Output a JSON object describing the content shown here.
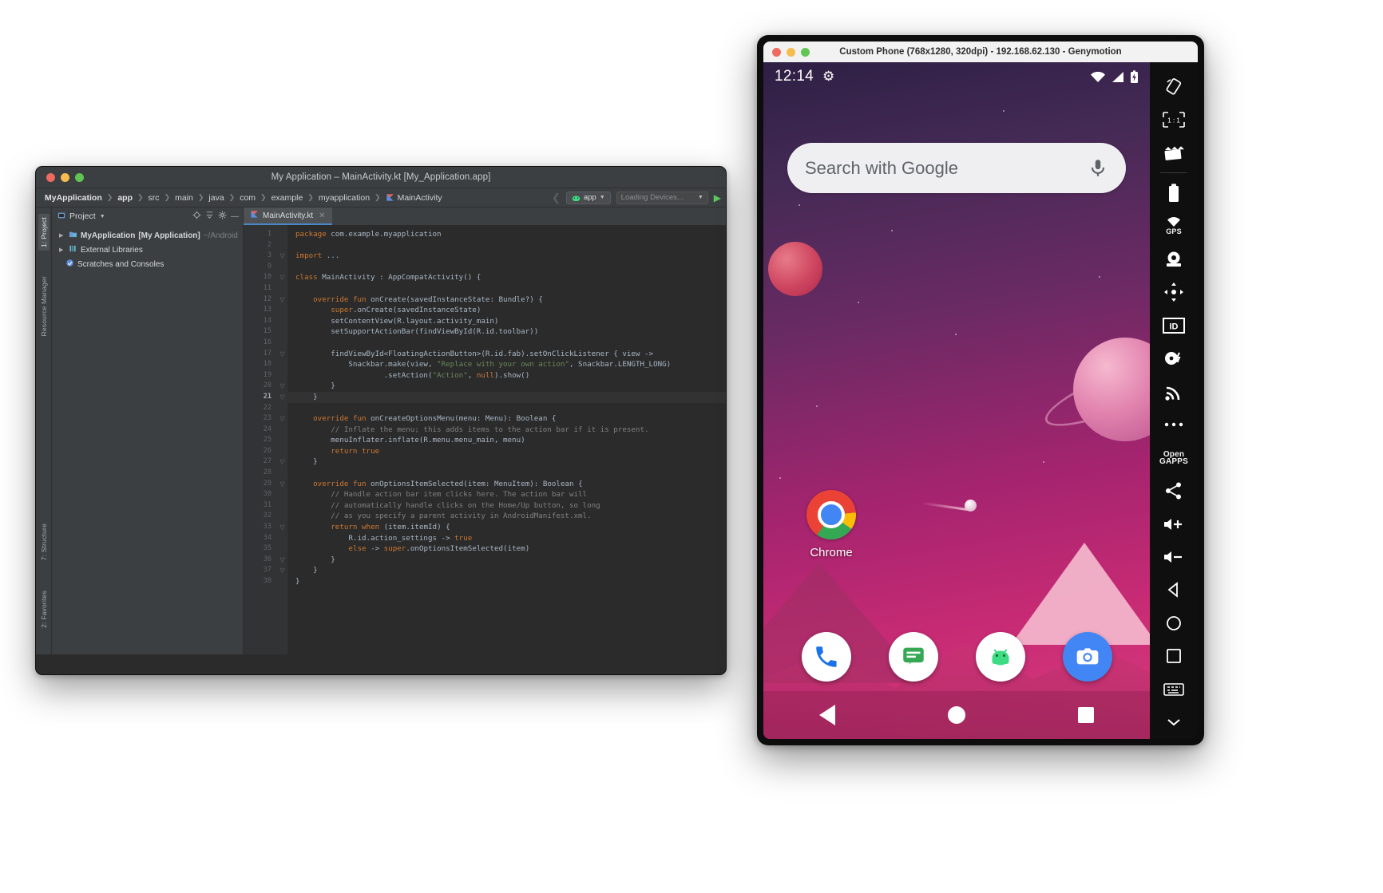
{
  "ide": {
    "title": "My Application – MainActivity.kt [My_Application.app]",
    "breadcrumb": [
      "MyApplication",
      "app",
      "src",
      "main",
      "java",
      "com",
      "example",
      "myapplication",
      "MainActivity"
    ],
    "run_config": "app",
    "device_selector": "Loading Devices...",
    "project_pane": {
      "title": "Project",
      "tree": [
        {
          "label": "MyApplication",
          "bracket": "[My Application]",
          "path": "~/Android",
          "icon": "module-icon"
        },
        {
          "label": "External Libraries",
          "bracket": "",
          "path": "",
          "icon": "library-icon"
        },
        {
          "label": "Scratches and Consoles",
          "bracket": "",
          "path": "",
          "icon": "scratch-icon"
        }
      ]
    },
    "tool_rail": [
      "1: Project",
      "Resource Manager",
      "7: Structure",
      "2: Favorites"
    ],
    "tab": {
      "label": "MainActivity.kt"
    },
    "editor": {
      "current_line": 21,
      "lines": [
        {
          "n": 1,
          "text": "package com.example.myapplication"
        },
        {
          "n": 2,
          "text": ""
        },
        {
          "n": 3,
          "text": "import ..."
        },
        {
          "n": 9,
          "text": ""
        },
        {
          "n": 10,
          "text": "class MainActivity : AppCompatActivity() {"
        },
        {
          "n": 11,
          "text": ""
        },
        {
          "n": 12,
          "text": "    override fun onCreate(savedInstanceState: Bundle?) {"
        },
        {
          "n": 13,
          "text": "        super.onCreate(savedInstanceState)"
        },
        {
          "n": 14,
          "text": "        setContentView(R.layout.activity_main)"
        },
        {
          "n": 15,
          "text": "        setSupportActionBar(findViewById(R.id.toolbar))"
        },
        {
          "n": 16,
          "text": ""
        },
        {
          "n": 17,
          "text": "        findViewById<FloatingActionButton>(R.id.fab).setOnClickListener { view ->"
        },
        {
          "n": 18,
          "text": "            Snackbar.make(view, \"Replace with your own action\", Snackbar.LENGTH_LONG)"
        },
        {
          "n": 19,
          "text": "                    .setAction(\"Action\", null).show()"
        },
        {
          "n": 20,
          "text": "        }"
        },
        {
          "n": 21,
          "text": "    }"
        },
        {
          "n": 22,
          "text": ""
        },
        {
          "n": 23,
          "text": "    override fun onCreateOptionsMenu(menu: Menu): Boolean {"
        },
        {
          "n": 24,
          "text": "        // Inflate the menu; this adds items to the action bar if it is present."
        },
        {
          "n": 25,
          "text": "        menuInflater.inflate(R.menu.menu_main, menu)"
        },
        {
          "n": 26,
          "text": "        return true"
        },
        {
          "n": 27,
          "text": "    }"
        },
        {
          "n": 28,
          "text": ""
        },
        {
          "n": 29,
          "text": "    override fun onOptionsItemSelected(item: MenuItem): Boolean {"
        },
        {
          "n": 30,
          "text": "        // Handle action bar item clicks here. The action bar will"
        },
        {
          "n": 31,
          "text": "        // automatically handle clicks on the Home/Up button, so long"
        },
        {
          "n": 32,
          "text": "        // as you specify a parent activity in AndroidManifest.xml."
        },
        {
          "n": 33,
          "text": "        return when (item.itemId) {"
        },
        {
          "n": 34,
          "text": "            R.id.action_settings -> true"
        },
        {
          "n": 35,
          "text": "            else -> super.onOptionsItemSelected(item)"
        },
        {
          "n": 36,
          "text": "        }"
        },
        {
          "n": 37,
          "text": "    }"
        },
        {
          "n": 38,
          "text": "}"
        }
      ]
    }
  },
  "genymotion": {
    "title": "Custom Phone (768x1280, 320dpi) - 192.168.62.130 - Genymotion",
    "device": {
      "clock": "12:14",
      "search_placeholder": "Search with Google",
      "app_label": "Chrome",
      "dock": [
        "phone-icon",
        "messages-icon",
        "play-store-icon",
        "camera-icon"
      ],
      "nav": [
        "back-button",
        "home-button",
        "recents-button"
      ]
    },
    "tools": [
      {
        "name": "rotate-icon",
        "label": ""
      },
      {
        "name": "resize-1to1-icon",
        "label": "1 : 1"
      },
      {
        "name": "screen-record-icon",
        "label": ""
      },
      {
        "name": "battery-icon",
        "label": ""
      },
      {
        "name": "gps-icon",
        "label": "GPS"
      },
      {
        "name": "camera-icon",
        "label": ""
      },
      {
        "name": "accelerometer-icon",
        "label": ""
      },
      {
        "name": "identifiers-icon",
        "label": "ID"
      },
      {
        "name": "disk-io-icon",
        "label": ""
      },
      {
        "name": "network-icon",
        "label": ""
      },
      {
        "name": "more-icon",
        "label": ""
      },
      {
        "name": "open-gapps-icon",
        "label": "Open GAPPS"
      },
      {
        "name": "share-icon",
        "label": ""
      },
      {
        "name": "volume-up-icon",
        "label": ""
      },
      {
        "name": "volume-down-icon",
        "label": ""
      },
      {
        "name": "back-icon",
        "label": ""
      },
      {
        "name": "home-icon",
        "label": ""
      },
      {
        "name": "recents-icon",
        "label": ""
      },
      {
        "name": "keyboard-icon",
        "label": ""
      },
      {
        "name": "expand-icon",
        "label": ""
      }
    ]
  }
}
